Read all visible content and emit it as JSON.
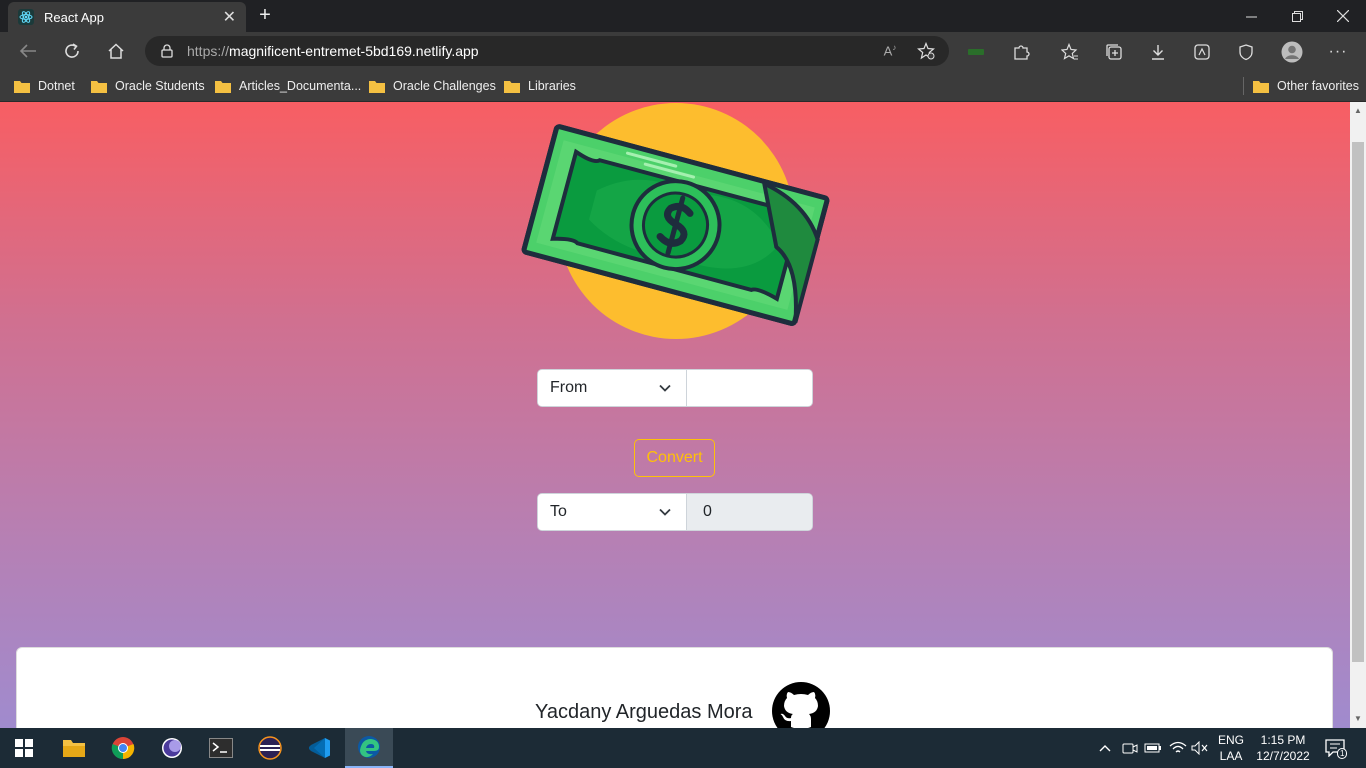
{
  "browser": {
    "tab_title": "React App",
    "url_prefix": "https://",
    "url_host": "magnificent-entremet-5bd169.netlify.app",
    "favorites": [
      {
        "label": "Dotnet"
      },
      {
        "label": "Oracle Students"
      },
      {
        "label": "Articles_Documenta..."
      },
      {
        "label": "Oracle Challenges"
      },
      {
        "label": "Libraries"
      }
    ],
    "other_favorites": "Other favorites"
  },
  "converter": {
    "from_label": "From",
    "from_amount": "",
    "convert_label": "Convert",
    "to_label": "To",
    "to_amount": "0",
    "accent_color": "#ffc107"
  },
  "footer": {
    "author": "Yacdany Arguedas Mora"
  },
  "taskbar": {
    "lang_top": "ENG",
    "lang_bottom": "LAA",
    "time": "1:15 PM",
    "date": "12/7/2022",
    "notification_count": "1"
  }
}
